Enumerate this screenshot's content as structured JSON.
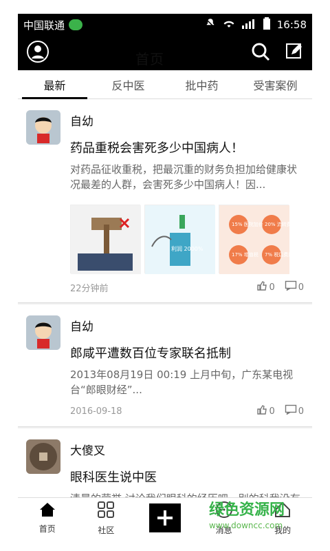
{
  "status_bar": {
    "carrier": "中国联通",
    "time": "16:58"
  },
  "app_bar": {
    "title": "首页",
    "icons": [
      "profile-icon",
      "search-icon",
      "edit-icon"
    ]
  },
  "tabs": [
    {
      "label": "最新",
      "active": true
    },
    {
      "label": "反中医",
      "active": false
    },
    {
      "label": "批中药",
      "active": false
    },
    {
      "label": "受害案例",
      "active": false
    }
  ],
  "feed": [
    {
      "author": "自幼",
      "title": "药品重税会害死多少中国病人！",
      "excerpt": "对药品征收重税，把最沉重的财务负担加给健康状况最差的人群，会害死多少中国病人！因...",
      "has_images": true,
      "image_text": {
        "img2": "利润 2000%",
        "img3_labels": [
          "15% 医院加价",
          "20% 流转费",
          "17% 增值税",
          "7% 税后费用"
        ]
      },
      "time": "22分钟前",
      "likes": "0",
      "comments": "0"
    },
    {
      "author": "自幼",
      "title": "郎咸平遭数百位专家联名抵制",
      "excerpt": "2013年08月19日 00:19  上月中旬，广东某电视台“郎眼财经”...",
      "has_images": false,
      "time": "2016-09-18",
      "likes": "0",
      "comments": "0"
    },
    {
      "author": "大傻叉",
      "title": "眼科医生说中医",
      "excerpt": "清晨的荣誉  讨论我们眼科的经历吧。别的科我没有发言权。 我不是...",
      "has_images": false
    }
  ],
  "bottom_nav": [
    {
      "label": "首页",
      "icon": "home-icon",
      "active": true
    },
    {
      "label": "社区",
      "icon": "grid-icon",
      "active": false
    },
    {
      "label": "",
      "icon": "plus-icon",
      "active": false
    },
    {
      "label": "消息",
      "icon": "message-icon",
      "active": false
    },
    {
      "label": "我的",
      "icon": "user-home-icon",
      "active": false
    }
  ],
  "watermark": {
    "title": "绿色资源网",
    "url": "www.downcc.com"
  }
}
